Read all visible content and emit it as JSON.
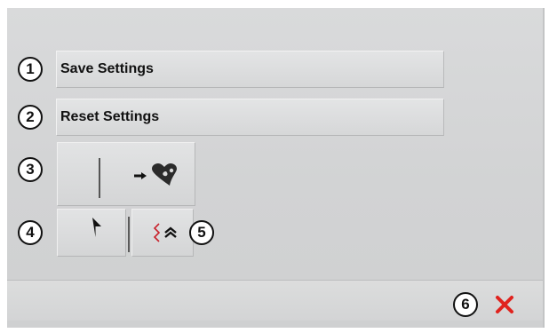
{
  "menu": {
    "items": [
      {
        "number": "1",
        "label": "Save Settings"
      },
      {
        "number": "2",
        "label": "Reset Settings"
      }
    ]
  },
  "buttons": {
    "three_number": "3",
    "four_number": "4",
    "five_number": "5",
    "close_number": "6"
  },
  "icons": {
    "export_arrow_heart": "arrow-to-heart-icon",
    "return": "return-arrow-icon",
    "stitch_up": "zigzag-double-chevron-up-icon",
    "close": "close-icon"
  },
  "colors": {
    "close_red": "#e0231e",
    "stitch_red": "#c8202a"
  }
}
